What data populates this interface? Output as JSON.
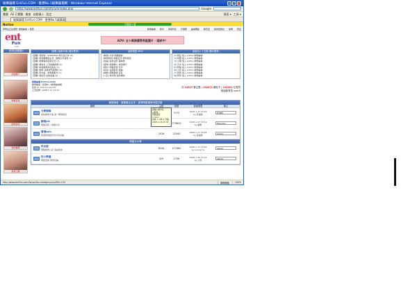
{
  "window": {
    "title": "娛樂論壇 EntFun.COM - 香港No.1娛樂論壇網 - Windows Internet Explorer"
  },
  "toolbar": {
    "address": "http://www.entfun.com/forum/index.php",
    "google_label": "Google",
    "links": [
      "書籤",
      "AE 已攔截",
      "檢查",
      "自動填入",
      "設定"
    ],
    "extra": [
      "頁面 ▾",
      "工具 ▾"
    ]
  },
  "tab": {
    "label": "娛樂論壇 EntFun.COM - 香港No.1娛樂論壇網"
  },
  "norton": {
    "brand": "Norton",
    "status": "已阻擋 0 個"
  },
  "topnav": {
    "left": "你現在正在瀏覽: 娛樂論壇 » 首頁",
    "items": [
      "娛樂論壇",
      "搜尋",
      "會員列表",
      "行事曆",
      "論壇圖版",
      "聊天室",
      "我的控制台",
      "說明",
      "登出"
    ]
  },
  "header": {
    "ad_text": "ADV: 五十萬張優質明星圖片 - 面試中！"
  },
  "leftcol": {
    "title": "[精選]活動圖片",
    "thumbs": [
      "靚相推介",
      "明星寫真",
      "娛樂快訊",
      "特別推薦",
      "最新上載"
    ]
  },
  "panels": [
    {
      "title": "[回覆] 最新50篇 (顯示更多)",
      "items": [
        "[回覆] 郭富城 - SHIKKEDO 吸引多元化 (0)",
        "[回覆] 易建聯聯盟主流 - 簡體文字報告 (1)",
        "[回覆] 姚明等候最新近況 (3)",
        "[回覆] 胡杏兒 上月拍攝新劇 (0)",
        "[回覆] 新城娛樂消息綜合 (2)",
        "[回覆] 黎明 演唱會門票發售 (5)",
        "[回覆] 周杰倫 - 新專輯曝光 (1)",
        "[回覆] 陳奕迅 最新單曲 (4)",
        "[回覆] 容祖兒 紅館演出 (0)",
        "[回覆] 楊千嬅 近照 (2)"
      ]
    },
    {
      "title": "最新發貼 NEW",
      "items": [
        "[娛樂] 大熱 明星觀察",
        "[娛樂新聞] 明星近況 專題報道",
        "[討論] 最新電影 首映禮",
        "[音樂] 新歌推介 本週排行",
        "[圖片] 明星寫真 高清",
        "[綜合] 電視節目 評論",
        "[娛樂] 頒獎典禮 直擊",
        "[八卦] 狗仔隊 最新爆料",
        "[劇集] 新劇預告 精彩片段",
        "[時尚] 明星穿搭 潮流"
      ]
    },
    {
      "title": "最新加入十五個 (顯示更多)",
      "items": [
        "[1] 阿彭 加入 entfun 娛樂論壇",
        "[2] 阿輝 加入 entfun 娛樂論壇",
        "[3] 小明 加入 entfun 娛樂論壇",
        "[4] 大文 加入 entfun 娛樂論壇",
        "[5] 阿強 加入 entfun 娛樂論壇",
        "[6] 小玲 加入 entfun 娛樂論壇",
        "[7] 阿華 加入 entfun 娛樂論壇",
        "[8] 阿珍 加入 entfun 娛樂論壇",
        "[9] 阿東 加入 entfun 娛樂論壇",
        "[10] 小芬 加入 entfun 娛樂論壇"
      ]
    }
  ],
  "userbox": {
    "name": "娛樂論壇 EntFun.COM",
    "line1": "娛樂論壇 - 香港No.1娛樂論壇網",
    "line2": "您的 IP: 219.xxx.xxx.67",
    "line3": "上次訪問: 2008-1-17 15:24"
  },
  "stats": {
    "line1_prefix": "共",
    "topics": "14527",
    "line1_mid": "篇主題 |",
    "posts": "156071",
    "line1_tail": "篇帖子 |",
    "members": "102902",
    "line1_end": "位會員",
    "line2": "歡迎新會員 npdr9"
  },
  "tooltip": [
    "請輸入用戶名",
    "以取得",
    "登錄設置",
    "1 mins",
    "訪客 1 小時 1 分鐘",
    "2008-1-18 15:35"
  ],
  "forum": {
    "section1": "娛樂論壇 - 娛樂最近近況 - 香港明星娛樂消息討論",
    "section2": "明星大小事",
    "columns": [
      "論壇",
      "主題",
      "帖數",
      "最後發表",
      "版主"
    ],
    "rows": [
      {
        "title": "大熱頭條",
        "desc": "最新娛樂大事 第一時間報道",
        "topics": "1597",
        "posts": "7175",
        "last1": "2008-1-17 15:50",
        "last2": "by 奶油熊",
        "mod": "奶油熊"
      },
      {
        "title": "靚相pic",
        "desc": "明星寫真 / 靚相分享",
        "topics": "5779",
        "posts": "779824",
        "last1": "2008-1-17 18:12",
        "last2": "by 曉明",
        "mod": "Moonfan"
      },
      {
        "title": "香港mtv",
        "desc": "香港音樂錄影帶分享討論",
        "topics": "2018",
        "posts": "22500",
        "last1": "2008-1-17 18:05",
        "last2": "by 奶油熊",
        "mod": "admin"
      },
      {
        "title": "吹水館",
        "desc": "閒聊娛樂八卦 自由發言",
        "topics": "8254",
        "posts": "171562",
        "last1": "2008-1-17 18:40",
        "last2": "by young ho",
        "mod": "ashgh"
      },
      {
        "title": "好小學擔",
        "desc": "明星回歸 專題討論",
        "topics": "429",
        "posts": "2708",
        "last1": "2008-1-16 23:41",
        "last2": "by 小熊",
        "mod": "ashgh"
      }
    ]
  },
  "statusbar": {
    "url": "http://www.entfun.com/forum/forumdisplay.php?fid=234",
    "zone": "網際網路",
    "zoom": "100%"
  }
}
